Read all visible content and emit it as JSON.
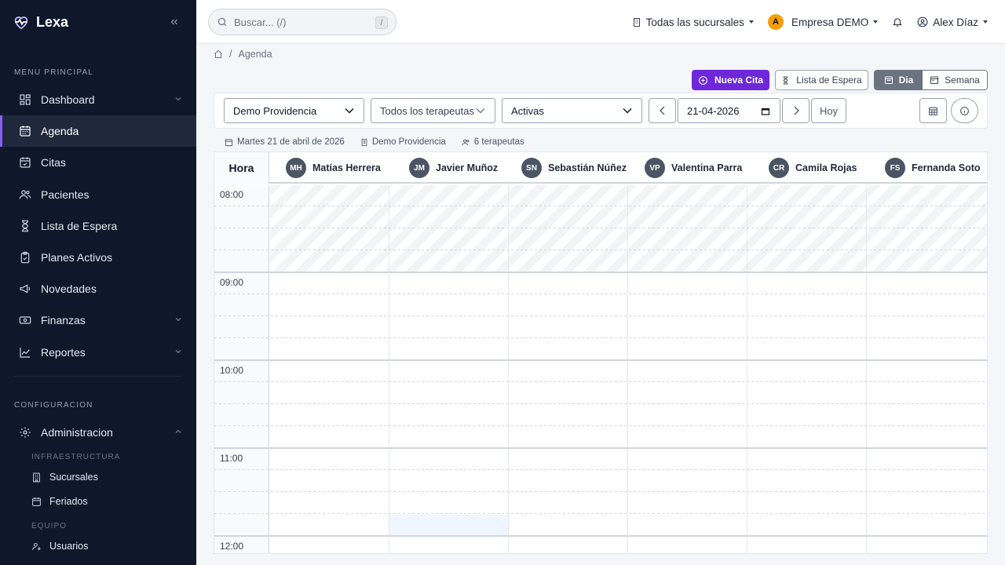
{
  "brand": {
    "name": "Lexa"
  },
  "sidebar": {
    "section_main": "MENU PRINCIPAL",
    "items": [
      {
        "label": "Dashboard"
      },
      {
        "label": "Agenda"
      },
      {
        "label": "Citas"
      },
      {
        "label": "Pacientes"
      },
      {
        "label": "Lista de Espera"
      },
      {
        "label": "Planes Activos"
      },
      {
        "label": "Novedades"
      },
      {
        "label": "Finanzas"
      },
      {
        "label": "Reportes"
      }
    ],
    "section_config": "CONFIGURACION",
    "admin_label": "Administracion",
    "sub_infra": "INFRAESTRUCTURA",
    "sub_items_infra": [
      {
        "label": "Sucursales"
      },
      {
        "label": "Feriados"
      }
    ],
    "sub_equipo": "EQUIPO",
    "sub_items_equipo": [
      {
        "label": "Usuarios"
      }
    ]
  },
  "topbar": {
    "search_placeholder": "Buscar... (/)",
    "search_kbd": "/",
    "branches": "Todas las sucursales",
    "company_initial": "A",
    "company": "Empresa DEMO",
    "user": "Alex Díaz"
  },
  "breadcrumb": {
    "current": "Agenda",
    "sep": "/"
  },
  "actions": {
    "new_appt": "Nueva Cita",
    "waitlist": "Lista de Espera",
    "view_day": "Dia",
    "view_week": "Semana"
  },
  "filters": {
    "branch": "Demo Providencia",
    "therapists": "Todos los terapeutas",
    "status": "Activas",
    "date": "21-04-2026",
    "today": "Hoy"
  },
  "meta": {
    "date_long": "Martes 21 de abril de 2026",
    "branch": "Demo Providencia",
    "count": "6 terapeutas"
  },
  "calendar": {
    "hour_header": "Hora",
    "therapists": [
      {
        "initials": "MH",
        "name": "Matías Herrera"
      },
      {
        "initials": "JM",
        "name": "Javier Muñoz"
      },
      {
        "initials": "SN",
        "name": "Sebastián Núñez"
      },
      {
        "initials": "VP",
        "name": "Valentina Parra"
      },
      {
        "initials": "CR",
        "name": "Camila Rojas"
      },
      {
        "initials": "FS",
        "name": "Fernanda Soto"
      }
    ],
    "hours": [
      "08:00",
      "09:00",
      "10:00",
      "11:00",
      "12:00"
    ]
  },
  "colors": {
    "accent": "#6d28d9",
    "sidebar_bg": "#0f172a",
    "active_border": "#8b5cf6"
  }
}
